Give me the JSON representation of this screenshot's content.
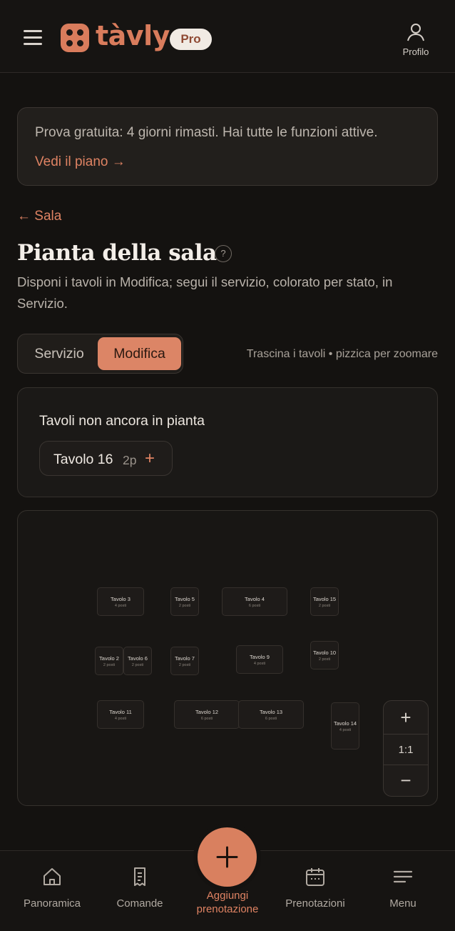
{
  "header": {
    "brand": "tàvly",
    "badge": "Pro",
    "profile_label": "Profilo",
    "icons": {
      "menu": "hamburger-icon",
      "logo": "dice-logo-icon",
      "profile": "user-icon"
    }
  },
  "trial": {
    "text": "Prova gratuita: 4 giorni rimasti. Hai tutte le funzioni attive.",
    "link": "Vedi il piano →"
  },
  "back_link": "← Sala",
  "page": {
    "title": "Pianta della sala",
    "help": "?",
    "description": "Disponi i tavoli in Modifica; segui il servizio, colorato per stato, in Servizio."
  },
  "mode": {
    "options": [
      "Servizio",
      "Modifica"
    ],
    "selected": "Modifica",
    "hint": "Trascina i tavoli • pizzica per zoomare"
  },
  "unplaced": {
    "title": "Tavoli non ancora in pianta",
    "tables": [
      {
        "name": "Tavolo 16",
        "seats": "2p",
        "add": "+"
      }
    ]
  },
  "floor": {
    "tables": [
      {
        "name": "Tavolo 3",
        "seats": "4 posti"
      },
      {
        "name": "Tavolo 5",
        "seats": "2 posti"
      },
      {
        "name": "Tavolo 4",
        "seats": "6 posti"
      },
      {
        "name": "Tavolo 15",
        "seats": "2 posti"
      },
      {
        "name": "Tavolo 2",
        "seats": "2 posti"
      },
      {
        "name": "Tavolo 6",
        "seats": "2 posti"
      },
      {
        "name": "Tavolo 7",
        "seats": "2 posti"
      },
      {
        "name": "Tavolo 9",
        "seats": "4 posti"
      },
      {
        "name": "Tavolo 10",
        "seats": "2 posti"
      },
      {
        "name": "Tavolo 11",
        "seats": "4 posti"
      },
      {
        "name": "Tavolo 12",
        "seats": "6 posti"
      },
      {
        "name": "Tavolo 13",
        "seats": "6 posti"
      },
      {
        "name": "Tavolo 14",
        "seats": "4 posti"
      }
    ],
    "zoom": {
      "in": "+",
      "reset": "1:1",
      "out": "−"
    }
  },
  "nav": {
    "items": [
      {
        "label": "Panoramica",
        "icon": "home-icon"
      },
      {
        "label": "Comande",
        "icon": "receipt-icon"
      },
      {
        "label": "Prenotazioni",
        "icon": "calendar-icon"
      },
      {
        "label": "Menu",
        "icon": "menu-lines-icon"
      }
    ],
    "fab_label": "Aggiungi prenotazione"
  },
  "colors": {
    "accent": "#d97c5c",
    "background": "#141210",
    "surface": "#1b1917"
  }
}
